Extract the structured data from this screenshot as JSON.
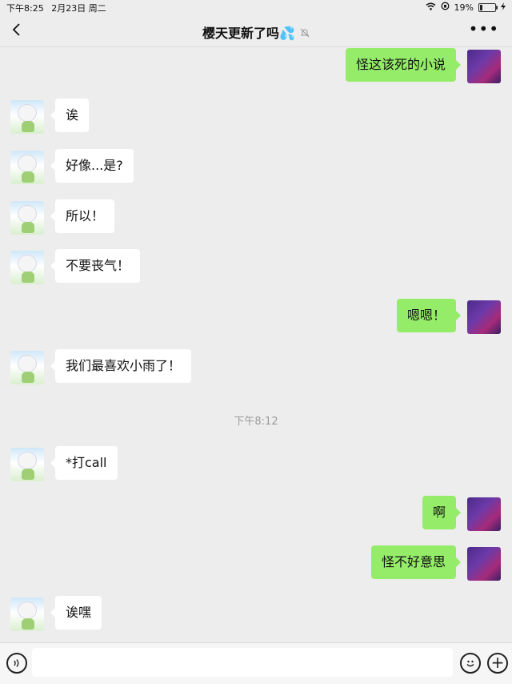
{
  "status_bar": {
    "time": "下午8:25",
    "date": "2月23日 周二",
    "battery_percent": "19%",
    "battery_level": 0.19,
    "icons": [
      "wifi-icon",
      "orientation-lock-icon",
      "battery-icon",
      "charging-icon"
    ]
  },
  "header": {
    "title": "樱天更新了吗",
    "title_emoji": "💦",
    "mute_icon": "bell-slash-icon",
    "back_icon": "chevron-left-icon",
    "more_icon": "more-dots-icon"
  },
  "messages": [
    {
      "side": "right",
      "text": "怪这该死的小说"
    },
    {
      "side": "left",
      "text": "诶"
    },
    {
      "side": "left",
      "text": "好像...是?"
    },
    {
      "side": "left",
      "text": "所以！"
    },
    {
      "side": "left",
      "text": "不要丧气！"
    },
    {
      "side": "right",
      "text": "嗯嗯！"
    },
    {
      "side": "left",
      "text": "我们最喜欢小雨了！"
    },
    {
      "side": "left",
      "text": "*打call"
    },
    {
      "side": "right",
      "text": "啊"
    },
    {
      "side": "right",
      "text": "怪不好意思"
    },
    {
      "side": "left",
      "text": "诶嘿"
    }
  ],
  "timestamp": "下午8:12",
  "input_bar": {
    "voice_icon": "voice-icon",
    "emoji_icon": "emoji-icon",
    "plus_icon": "plus-icon",
    "text_value": ""
  },
  "colors": {
    "background": "#ededed",
    "outgoing_bubble": "#95ec69",
    "incoming_bubble": "#ffffff"
  }
}
